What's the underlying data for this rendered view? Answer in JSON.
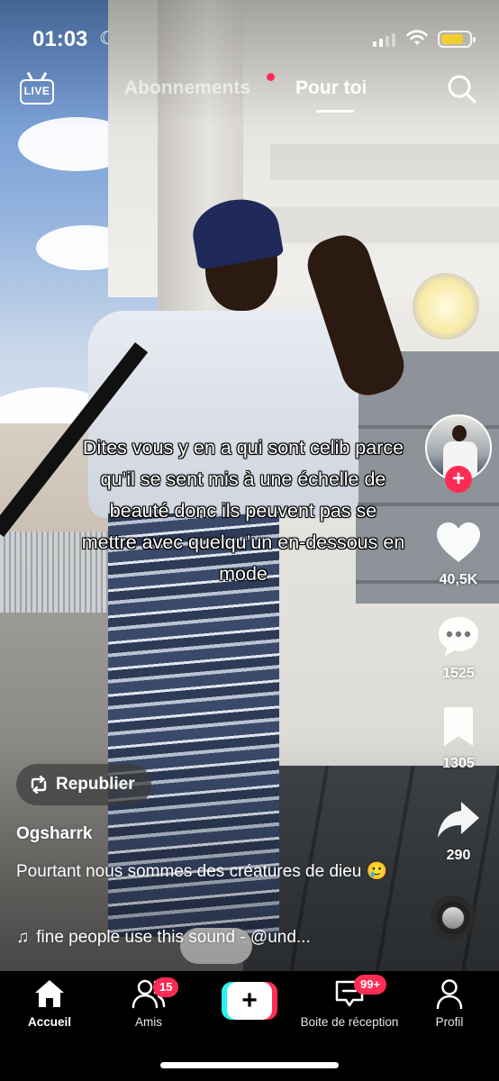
{
  "status_bar": {
    "time": "01:03",
    "battery_level": 0.8,
    "battery_color": "#f2cd2e"
  },
  "top_nav": {
    "live_label": "LIVE",
    "tabs": [
      {
        "label": "Abonnements",
        "active": false,
        "has_notification_dot": true
      },
      {
        "label": "Pour toi",
        "active": true
      }
    ]
  },
  "video": {
    "caption": "Dites vous y en a qui sont celib parce qu’il se sent mis à une échelle de beauté donc ils peuvent pas se mettre avec quelqu’un en-dessous en mode"
  },
  "actions": {
    "likes": "40,5K",
    "comments": "1525",
    "saves": "1305",
    "shares": "290"
  },
  "post": {
    "republier_label": "Republier",
    "username": "Ogsharrk",
    "description": "Pourtant nous sommes des créatures de dieu 🥲",
    "sound": "fine people use this sound - @und..."
  },
  "tab_bar": {
    "items": [
      {
        "label": "Accueil",
        "active": true
      },
      {
        "label": "Amis",
        "badge": "15"
      },
      {
        "label": "Boite de réception",
        "badge": "99+"
      },
      {
        "label": "Profil"
      }
    ],
    "create_label": "+"
  },
  "colors": {
    "accent_red": "#fe2c55",
    "accent_cyan": "#25f4ee"
  }
}
